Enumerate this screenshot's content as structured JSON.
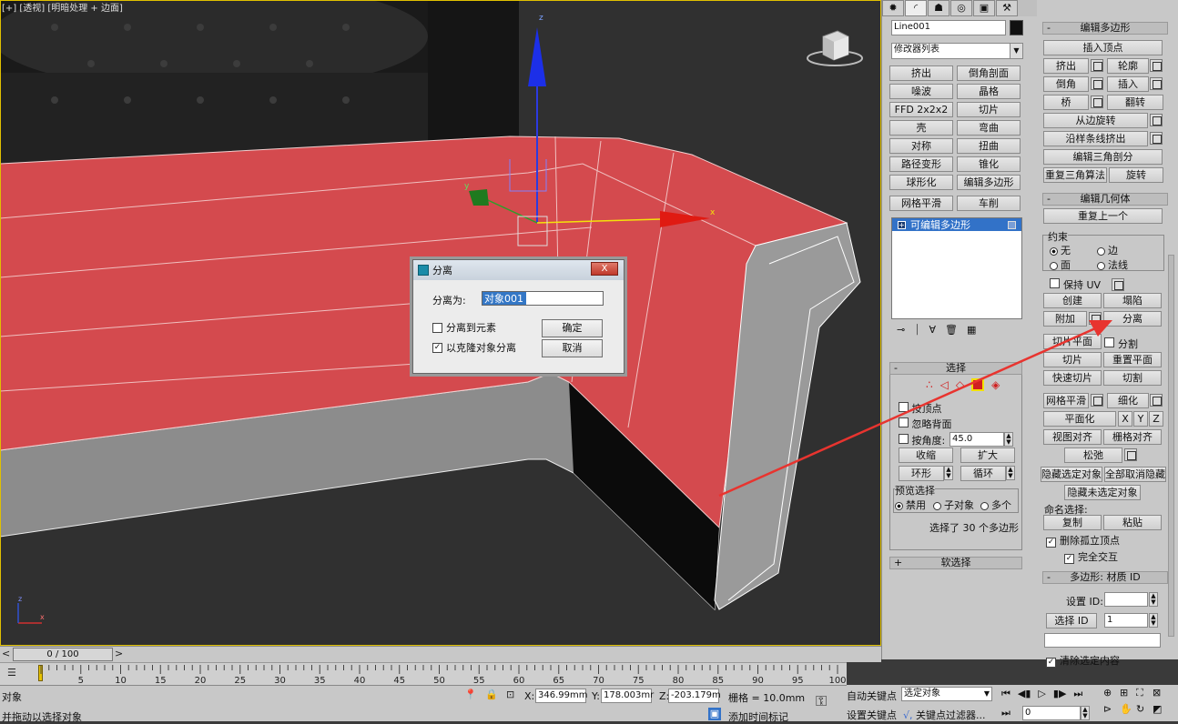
{
  "viewport": {
    "label": "[+] [透视] [明暗处理 + 边面]",
    "axis": {
      "x": "x",
      "y": "y",
      "z": "z"
    },
    "triad": {
      "x": "x",
      "z": "z"
    }
  },
  "dialog": {
    "title": "分离",
    "close_label": "X",
    "name_label": "分离为:",
    "name_value": "对象001",
    "detach_to_element_label": "分离到元素",
    "detach_as_clone_label": "以克隆对象分离",
    "ok_label": "确定",
    "cancel_label": "取消"
  },
  "panel": {
    "object_name": "Line001",
    "modifier_list": "修改器列表",
    "modifier_buttons": [
      "挤出",
      "倒角剖面",
      "噪波",
      "晶格",
      "FFD 2x2x2",
      "切片",
      "壳",
      "弯曲",
      "对称",
      "扭曲",
      "路径变形",
      "锥化",
      "球形化",
      "编辑多边形",
      "网格平滑",
      "车削"
    ],
    "stack_item": "可编辑多边形",
    "stack_plus": "+",
    "tool_icons": [
      "pin-icon",
      "show-end-result-icon",
      "make-unique-icon",
      "remove-modifier-icon",
      "configure-icon"
    ],
    "select_rollout": {
      "title": "选择",
      "by_vertex": "按顶点",
      "ignore_backfacing": "忽略背面",
      "by_angle": "按角度:",
      "angle_value": "45.0",
      "shrink": "收缩",
      "grow": "扩大",
      "ring": "环形",
      "loop": "循环",
      "preview_title": "预览选择",
      "preview_off": "禁用",
      "preview_subobj": "子对象",
      "preview_multi": "多个",
      "status": "选择了 30 个多边形"
    },
    "soft_select": "软选择",
    "edit_polygons": {
      "title": "编辑多边形",
      "insert_vertex": "插入顶点",
      "extrude": "挤出",
      "outline": "轮廓",
      "bevel": "倒角",
      "inset": "插入",
      "bridge": "桥",
      "flip": "翻转",
      "hinge": "从边旋转",
      "extrude_spline": "沿样条线挤出",
      "edit_tri": "编辑三角剖分",
      "retriangulate": "重复三角算法",
      "turn": "旋转"
    },
    "edit_geometry": {
      "title": "编辑几何体",
      "repeat_last": "重复上一个",
      "constraints": "约束",
      "c_none": "无",
      "c_edge": "边",
      "c_face": "面",
      "c_normal": "法线",
      "preserve_uv": "保持 UV",
      "create": "创建",
      "collapse": "塌陷",
      "attach": "附加",
      "detach": "分离",
      "slice_plane": "切片平面",
      "split": "分割",
      "slice": "切片",
      "reset_plane": "重置平面",
      "quickslice": "快速切片",
      "cut": "切割",
      "meshsmooth": "网格平滑",
      "tessellate": "细化",
      "planarize": "平面化",
      "px": "X",
      "py": "Y",
      "pz": "Z",
      "view_align": "视图对齐",
      "grid_align": "栅格对齐",
      "relax": "松弛",
      "hide_selected": "隐藏选定对象",
      "unhide_all": "全部取消隐藏",
      "hide_unselected": "隐藏未选定对象",
      "named_sel": "命名选择:",
      "copy": "复制",
      "paste": "粘贴",
      "delete_isolated": "删除孤立顶点",
      "full_interactivity": "完全交互"
    },
    "material_ids": {
      "title": "多边形: 材质 ID",
      "set_id": "设置 ID:",
      "select_id": "选择 ID",
      "select_id_value": "1",
      "clear_selection": "清除选定内容"
    }
  },
  "timeline": {
    "frame": "0 / 100",
    "ticks": [
      "5",
      "10",
      "15",
      "20",
      "25",
      "30",
      "35",
      "40",
      "45",
      "50",
      "55",
      "60",
      "65",
      "70",
      "75",
      "80",
      "85",
      "90",
      "95",
      "100"
    ]
  },
  "status": {
    "line1": "对象",
    "line2": "并拖动以选择对象",
    "x_label": "X:",
    "x_value": "346.99mm",
    "y_label": "Y:",
    "y_value": "178.003mr",
    "z_label": "Z:",
    "z_value": "-203.179m",
    "grid": "栅格 = 10.0mm",
    "add_time_tag": "添加时间标记",
    "auto_key": "自动关键点",
    "selected_object": "选定对象",
    "set_key": "设置关键点",
    "key_filters": "关键点过滤器...",
    "current_frame": "0"
  },
  "colors": {
    "selection_red": "#d8484c",
    "arrow_red": "#e8342f",
    "stack_blue": "#3272c8"
  }
}
